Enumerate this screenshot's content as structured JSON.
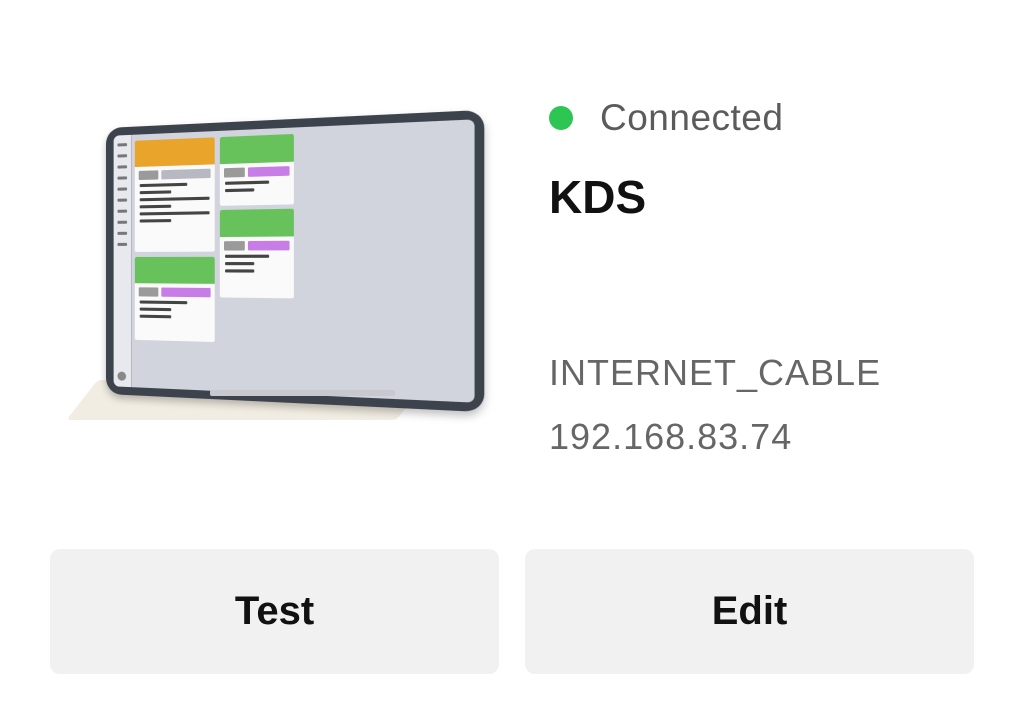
{
  "printer": {
    "status": "Connected",
    "status_color": "#2dc653",
    "name": "KDS",
    "connection_type": "INTERNET_CABLE",
    "ip_address": "192.168.83.74"
  },
  "actions": {
    "test_label": "Test",
    "edit_label": "Edit"
  },
  "illustration": {
    "icon": "kds-tablet-illustration"
  }
}
